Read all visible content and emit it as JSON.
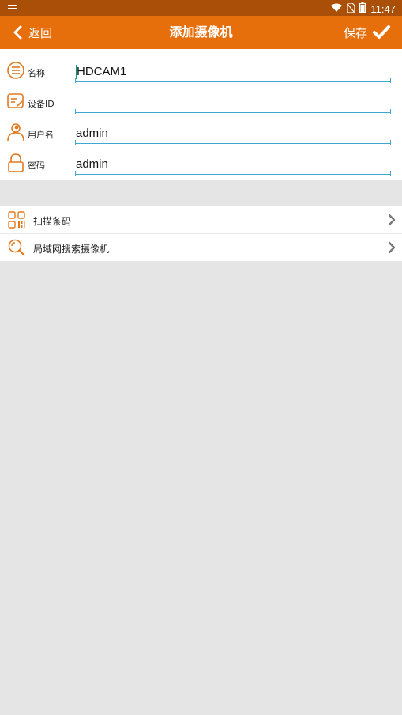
{
  "status_bar": {
    "time": "11:47"
  },
  "header": {
    "back_label": "返回",
    "title": "添加摄像机",
    "save_label": "保存"
  },
  "form": {
    "fields": [
      {
        "label": "名称",
        "value": "HDCAM1",
        "icon": "name-icon"
      },
      {
        "label": "设备ID",
        "value": "",
        "icon": "device-id-icon"
      },
      {
        "label": "用户名",
        "value": "admin",
        "icon": "user-icon"
      },
      {
        "label": "密码",
        "value": "admin",
        "icon": "lock-icon"
      }
    ]
  },
  "actions": [
    {
      "label": "扫描条码",
      "icon": "qr-code-icon"
    },
    {
      "label": "局域网搜索摄像机",
      "icon": "magnifier-icon"
    }
  ],
  "colors": {
    "accent": "#e66f0c",
    "status_bar": "#a94f07",
    "underline": "#3fa7d6",
    "background": "#e5e5e5"
  }
}
